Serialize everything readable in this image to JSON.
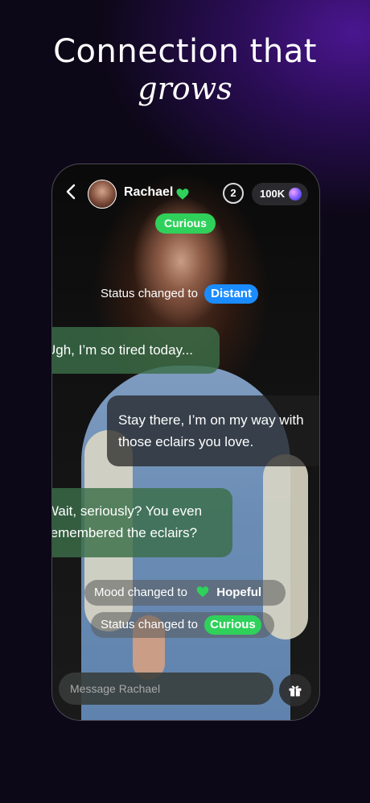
{
  "headline": {
    "line1": "Connection that",
    "line2": "grows"
  },
  "header": {
    "contact_name": "Rachael",
    "counter": "2",
    "coins": "100K"
  },
  "status_top": "Curious",
  "status_change_1": {
    "text": "Status changed to",
    "value": "Distant"
  },
  "messages": [
    {
      "from": "user",
      "text": "Ugh, I’m so tired today..."
    },
    {
      "from": "character",
      "text": "Stay there, I’m on my way with those eclairs you love."
    },
    {
      "from": "user",
      "text": "Wait, seriously?  You even remembered the eclairs?"
    }
  ],
  "mood_change": {
    "text": "Mood changed to",
    "value": "Hopeful"
  },
  "status_change_2": {
    "text": "Status changed to",
    "value": "Curious"
  },
  "composer": {
    "placeholder": "Message Rachael"
  },
  "colors": {
    "accent_green": "#2fd15a",
    "accent_blue": "#1a8cff",
    "bg_purple": "#4a1690"
  },
  "icons": [
    "back-icon",
    "heart-icon",
    "gem-icon",
    "gift-icon"
  ]
}
